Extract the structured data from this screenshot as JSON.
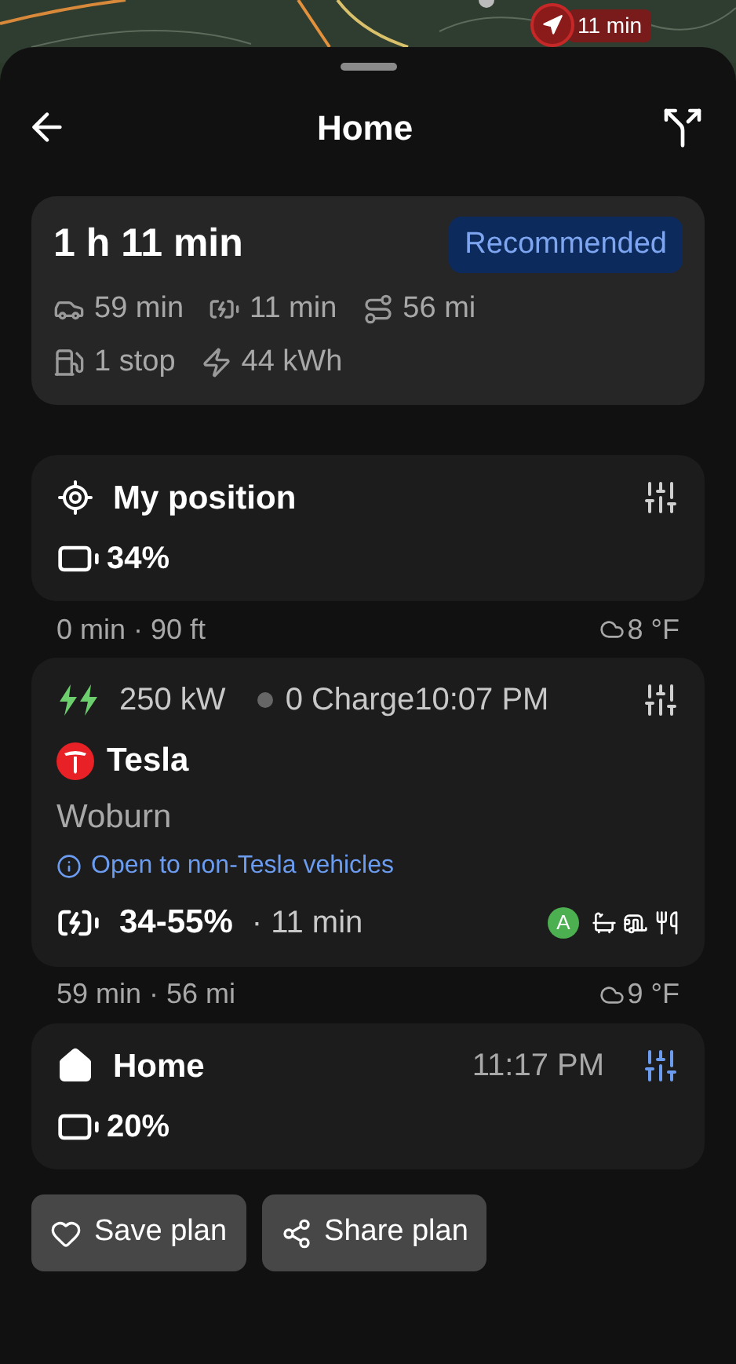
{
  "map": {
    "marker_label": "11 min"
  },
  "header": {
    "title": "Home"
  },
  "summary": {
    "duration": "1 h 11 min",
    "badge": "Recommended",
    "stats": [
      {
        "kind": "drive",
        "text": "59 min"
      },
      {
        "kind": "charge",
        "text": "11 min"
      },
      {
        "kind": "distance",
        "text": "56 mi"
      },
      {
        "kind": "stops",
        "text": "1 stop"
      },
      {
        "kind": "energy",
        "text": "44 kWh"
      }
    ]
  },
  "stops": [
    {
      "kind": "origin",
      "name": "My position",
      "battery": "34%",
      "settings_active": false
    },
    {
      "kind": "leg",
      "text": "0 min · 90 ft",
      "weather": "8 °F"
    },
    {
      "kind": "charger",
      "power": "250 kW",
      "availability": "0 Charge",
      "time": "10:07 PM",
      "settings_active": false,
      "name": "Tesla",
      "city": "Woburn",
      "note": "Open to non-Tesla vehicles",
      "charge_range": "34-55%",
      "charge_time": "· 11 min",
      "amenity_badge": "A"
    },
    {
      "kind": "leg",
      "text": "59 min · 56 mi",
      "weather": "9 °F"
    },
    {
      "kind": "destination",
      "name": "Home",
      "time": "11:17 PM",
      "battery": "20%",
      "settings_active": true
    }
  ],
  "actions": [
    {
      "kind": "save",
      "label": "Save plan"
    },
    {
      "kind": "share",
      "label": "Share plan"
    }
  ]
}
